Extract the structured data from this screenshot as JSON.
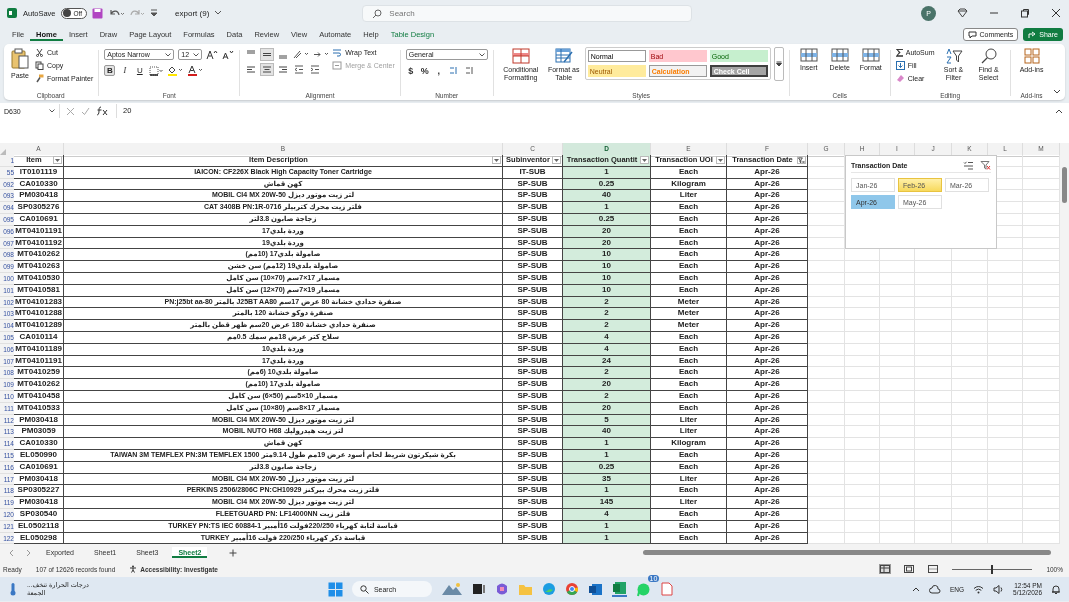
{
  "titlebar": {
    "autosave": "AutoSave",
    "autosave_on": false,
    "autosave_state": "Off",
    "filename": "export (9)",
    "search_placeholder": "Search",
    "avatar": "P"
  },
  "menu_tabs": [
    {
      "label": "File",
      "selected": false
    },
    {
      "label": "Home",
      "selected": true
    },
    {
      "label": "Insert",
      "selected": false
    },
    {
      "label": "Draw",
      "selected": false
    },
    {
      "label": "Page Layout",
      "selected": false
    },
    {
      "label": "Formulas",
      "selected": false
    },
    {
      "label": "Data",
      "selected": false
    },
    {
      "label": "Review",
      "selected": false
    },
    {
      "label": "View",
      "selected": false
    },
    {
      "label": "Automate",
      "selected": false
    },
    {
      "label": "Help",
      "selected": false
    },
    {
      "label": "Table Design",
      "selected": false,
      "kind": "contextual"
    }
  ],
  "comments": "Comments",
  "share": "Share",
  "ribbon": {
    "clipboard": {
      "paste": "Paste",
      "cut": "Cut",
      "copy": "Copy",
      "format_painter": "Format Painter",
      "label": "Clipboard"
    },
    "font": {
      "name": "Aptos Narrow",
      "size": "12",
      "format_buttons": [
        {
          "label": "B",
          "selected": true
        },
        {
          "label": "I",
          "selected": false
        },
        {
          "label": "U",
          "selected": false
        }
      ],
      "label": "Font"
    },
    "alignment": {
      "wrap_text": "Wrap Text",
      "merge_center": "Merge & Center",
      "merge_disabled": true,
      "label": "Alignment"
    },
    "number": {
      "format": "General",
      "symbols": [
        "$",
        "%",
        ","
      ],
      "label": "Number"
    },
    "styles": {
      "conditional": "Conditional Formatting",
      "format_table": "Format as Table",
      "cells": [
        {
          "label": "Normal",
          "kind": "normal"
        },
        {
          "label": "Bad",
          "kind": "bad"
        },
        {
          "label": "Good",
          "kind": "good"
        },
        {
          "label": "Neutral",
          "kind": "neutral"
        },
        {
          "label": "Calculation",
          "kind": "calculation"
        },
        {
          "label": "Check Cell",
          "kind": "check"
        }
      ],
      "label": "Styles"
    },
    "cells": {
      "buttons": [
        "Insert",
        "Delete",
        "Format"
      ],
      "label": "Cells"
    },
    "editing": {
      "autosum": "AutoSum",
      "fill": "Fill",
      "clear": "Clear",
      "sort": "Sort & Filter",
      "find": "Find & Select",
      "label": "Editing"
    },
    "addins": {
      "button": "Add-ins",
      "label": "Add-ins"
    }
  },
  "formula_bar": {
    "name_box": "D630",
    "value": "20"
  },
  "columns": [
    {
      "letter": "A",
      "selected": false
    },
    {
      "letter": "B",
      "selected": false
    },
    {
      "letter": "C",
      "selected": false
    },
    {
      "letter": "D",
      "selected": true
    },
    {
      "letter": "E",
      "selected": false
    },
    {
      "letter": "F",
      "selected": false
    },
    {
      "letter": "G",
      "selected": false
    },
    {
      "letter": "H",
      "selected": false
    },
    {
      "letter": "I",
      "selected": false
    },
    {
      "letter": "J",
      "selected": false
    },
    {
      "letter": "K",
      "selected": false
    },
    {
      "letter": "L",
      "selected": false
    },
    {
      "letter": "M",
      "selected": false
    }
  ],
  "table": {
    "header_row": "1",
    "headers": [
      {
        "label": "Item",
        "filtered": false
      },
      {
        "label": "Item Description",
        "filtered": false
      },
      {
        "label": "Subinventor",
        "filtered": false
      },
      {
        "label": "Transaction Quantit",
        "filtered": false
      },
      {
        "label": "Transaction UOI",
        "filtered": false
      },
      {
        "label": "Transaction Date",
        "filtered": true
      }
    ],
    "rows": [
      {
        "n": "55",
        "item": "IT0101119",
        "desc": "IAICON: CF226X Black High Capacity Toner Cartridge",
        "sub": "IT-SUB",
        "qty": "1",
        "uom": "Each",
        "date": "Apr-26"
      },
      {
        "n": "092",
        "item": "CA010330",
        "desc": "كهن قماش",
        "sub": "SP-SUB",
        "qty": "0.25",
        "uom": "Kilogram",
        "date": "Apr-26"
      },
      {
        "n": "093",
        "item": "PM030418",
        "desc": "لتر زيت موتور ديزل MOBIL CI4 MX 20W-50",
        "sub": "SP-SUB",
        "qty": "40",
        "uom": "Liter",
        "date": "Apr-26"
      },
      {
        "n": "094",
        "item": "SP0305276",
        "desc": "فلتر زيت محرك كتربيلر CAT 3408B PN:1R-0716",
        "sub": "SP-SUB",
        "qty": "1",
        "uom": "Each",
        "date": "Apr-26"
      },
      {
        "n": "095",
        "item": "CA010691",
        "desc": "زجاجة صابون 3.8لتر",
        "sub": "SP-SUB",
        "qty": "0.25",
        "uom": "Each",
        "date": "Apr-26"
      },
      {
        "n": "096",
        "item": "MT04101191",
        "desc": "وردة بلدي17",
        "sub": "SP-SUB",
        "qty": "20",
        "uom": "Each",
        "date": "Apr-26"
      },
      {
        "n": "097",
        "item": "MT04101192",
        "desc": "وردة بلدي19",
        "sub": "SP-SUB",
        "qty": "20",
        "uom": "Each",
        "date": "Apr-26"
      },
      {
        "n": "098",
        "item": "MT0410262",
        "desc": "صامولة بلدي17 (10مم)",
        "sub": "SP-SUB",
        "qty": "10",
        "uom": "Each",
        "date": "Apr-26"
      },
      {
        "n": "099",
        "item": "MT0410263",
        "desc": "صامولة بلدي19 (12مم) سن خشن",
        "sub": "SP-SUB",
        "qty": "10",
        "uom": "Each",
        "date": "Apr-26"
      },
      {
        "n": "100",
        "item": "MT0410530",
        "desc": "مسمار 17×7سم (70×10) سن كامل",
        "sub": "SP-SUB",
        "qty": "10",
        "uom": "Each",
        "date": "Apr-26"
      },
      {
        "n": "101",
        "item": "MT0410581",
        "desc": "مسمار 19×7سم (70×12) سن كامل",
        "sub": "SP-SUB",
        "qty": "10",
        "uom": "Each",
        "date": "Apr-26"
      },
      {
        "n": "102",
        "item": "MT04101283",
        "desc": "صنفرة حدادي خشانة 80 عرض 17سم J25BT AA80 بالمتر PN:j25bt aa-80",
        "sub": "SP-SUB",
        "qty": "2",
        "uom": "Meter",
        "date": "Apr-26"
      },
      {
        "n": "103",
        "item": "MT04101288",
        "desc": "صنفرة دوكو خشانة 120 بالمتر",
        "sub": "SP-SUB",
        "qty": "2",
        "uom": "Meter",
        "date": "Apr-26"
      },
      {
        "n": "104",
        "item": "MT04101289",
        "desc": "صنفرة حدادي خشانة 180 عرض 20سم ظهر قطن بالمتر",
        "sub": "SP-SUB",
        "qty": "2",
        "uom": "Meter",
        "date": "Apr-26"
      },
      {
        "n": "105",
        "item": "CA010114",
        "desc": "سلاح كتر عرض 18مم سمك 0.5مم",
        "sub": "SP-SUB",
        "qty": "4",
        "uom": "Each",
        "date": "Apr-26"
      },
      {
        "n": "106",
        "item": "MT04101189",
        "desc": "وردة بلدي10",
        "sub": "SP-SUB",
        "qty": "4",
        "uom": "Each",
        "date": "Apr-26"
      },
      {
        "n": "107",
        "item": "MT04101191",
        "desc": "وردة بلدي17",
        "sub": "SP-SUB",
        "qty": "24",
        "uom": "Each",
        "date": "Apr-26"
      },
      {
        "n": "108",
        "item": "MT0410259",
        "desc": "صامولة بلدي10 (6مم)",
        "sub": "SP-SUB",
        "qty": "2",
        "uom": "Each",
        "date": "Apr-26"
      },
      {
        "n": "109",
        "item": "MT0410262",
        "desc": "صامولة بلدي17 (10مم)",
        "sub": "SP-SUB",
        "qty": "20",
        "uom": "Each",
        "date": "Apr-26"
      },
      {
        "n": "110",
        "item": "MT0410458",
        "desc": "مسمار 10×5سم (50×6) سن كامل",
        "sub": "SP-SUB",
        "qty": "2",
        "uom": "Each",
        "date": "Apr-26"
      },
      {
        "n": "111",
        "item": "MT0410533",
        "desc": "مسمار 17×8سم (80×10) سن كامل",
        "sub": "SP-SUB",
        "qty": "20",
        "uom": "Each",
        "date": "Apr-26"
      },
      {
        "n": "112",
        "item": "PM030418",
        "desc": "لتر زيت موتور ديزل MOBIL CI4 MX 20W-50",
        "sub": "SP-SUB",
        "qty": "5",
        "uom": "Liter",
        "date": "Apr-26"
      },
      {
        "n": "113",
        "item": "PM03059",
        "desc": "لتر زيت هيدروليك MOBIL NUTO H68",
        "sub": "SP-SUB",
        "qty": "40",
        "uom": "Liter",
        "date": "Apr-26"
      },
      {
        "n": "114",
        "item": "CA010330",
        "desc": "كهن قماش",
        "sub": "SP-SUB",
        "qty": "1",
        "uom": "Kilogram",
        "date": "Apr-26"
      },
      {
        "n": "115",
        "item": "EL050990",
        "desc": "بكرة شيكرتون شريط لحام أسود عرض 19مم طول 9.14متر TAIWAN 3M TEMFLEX PN:3M TEMFLEX 1500",
        "sub": "SP-SUB",
        "qty": "1",
        "uom": "Each",
        "date": "Apr-26"
      },
      {
        "n": "116",
        "item": "CA010691",
        "desc": "زجاجة صابون 3.8لتر",
        "sub": "SP-SUB",
        "qty": "0.25",
        "uom": "Each",
        "date": "Apr-26"
      },
      {
        "n": "117",
        "item": "PM030418",
        "desc": "لتر زيت موتور ديزل MOBIL CI4 MX 20W-50",
        "sub": "SP-SUB",
        "qty": "35",
        "uom": "Liter",
        "date": "Apr-26"
      },
      {
        "n": "118",
        "item": "SP0305227",
        "desc": "فلتر زيت محرك بيركنز PERKINS 2506/2806C PN:CH10929",
        "sub": "SP-SUB",
        "qty": "1",
        "uom": "Each",
        "date": "Apr-26"
      },
      {
        "n": "119",
        "item": "PM030418",
        "desc": "لتر زيت موتور ديزل MOBIL CI4 MX 20W-50",
        "sub": "SP-SUB",
        "qty": "145",
        "uom": "Liter",
        "date": "Apr-26"
      },
      {
        "n": "120",
        "item": "SP030540",
        "desc": "فلتر زيت FLEETGUARD PN: LF14000NN",
        "sub": "SP-SUB",
        "qty": "4",
        "uom": "Each",
        "date": "Apr-26"
      },
      {
        "n": "121",
        "item": "EL0502118",
        "desc": "قباسة لتابة كهرباء 220/250فولت 16أمبير TURKEY PN:TS IEC 60884-1",
        "sub": "SP-SUB",
        "qty": "1",
        "uom": "Each",
        "date": "Apr-26"
      },
      {
        "n": "122",
        "item": "EL050298",
        "desc": "قباسة ذكر كهرباء 220/250 فولت 16أمبير TURKEY",
        "sub": "SP-SUB",
        "qty": "1",
        "uom": "Each",
        "date": "Apr-26"
      }
    ]
  },
  "slicer": {
    "title": "Transaction Date",
    "items": [
      {
        "label": "Jan-26",
        "selected": false,
        "hovered": false
      },
      {
        "label": "Feb-26",
        "selected": false,
        "hovered": true
      },
      {
        "label": "Mar-26",
        "selected": false,
        "hovered": false
      },
      {
        "label": "Apr-26",
        "selected": true,
        "hovered": false
      },
      {
        "label": "May-26",
        "selected": false,
        "hovered": false
      }
    ]
  },
  "sheet_tabs": [
    {
      "label": "Exported",
      "selected": false
    },
    {
      "label": "Sheet1",
      "selected": false
    },
    {
      "label": "Sheet3",
      "selected": false
    },
    {
      "label": "Sheet2",
      "selected": true
    }
  ],
  "status_bar": {
    "mode": "Ready",
    "records": "107 of 12626 records found",
    "accessibility": "Accessibility: Investigate",
    "zoom": "100%",
    "zoom_slider": {
      "level": 0.5
    }
  },
  "taskbar": {
    "weather": "درجات الحرارة تنخف...",
    "weather_day": "الجمعة",
    "search": "Search",
    "badge": "10",
    "language": "ENG",
    "time": "12:54 PM",
    "date": "5/12/2026"
  }
}
